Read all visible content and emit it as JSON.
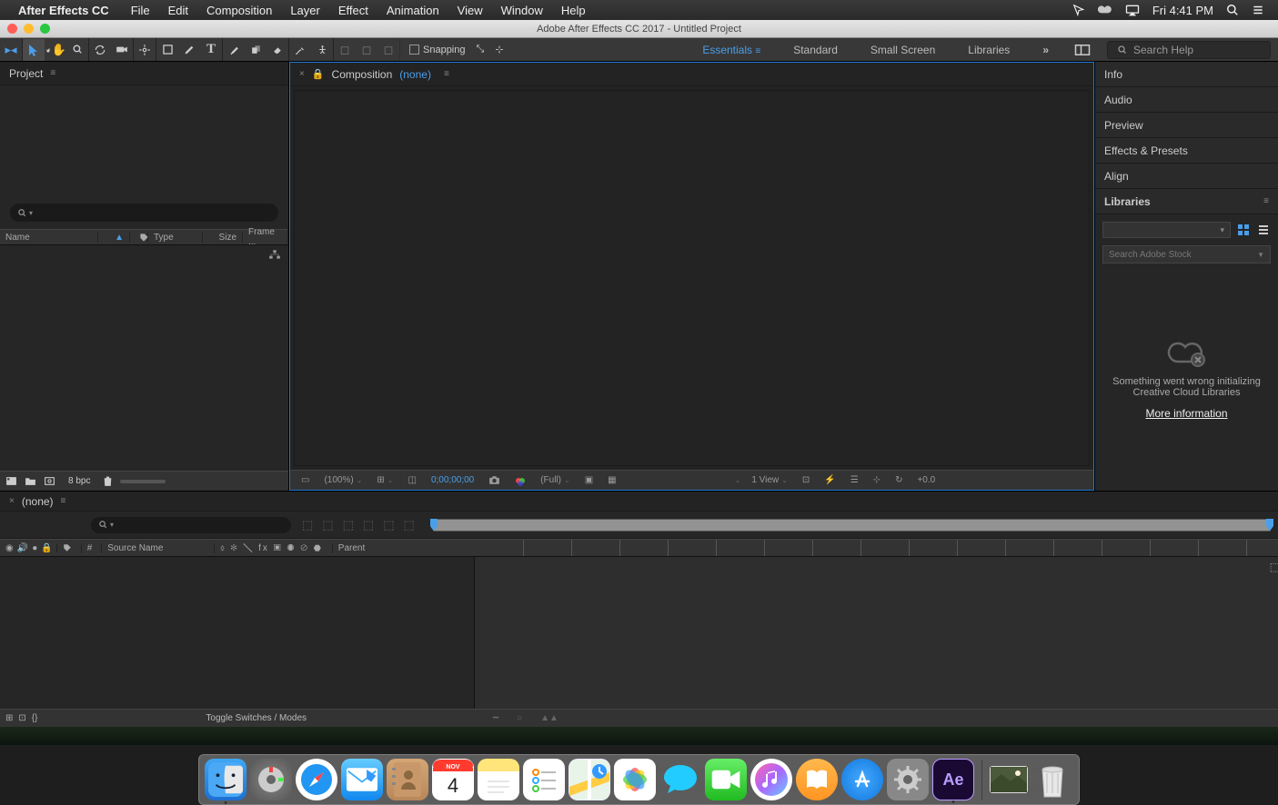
{
  "menubar": {
    "app_name": "After Effects CC",
    "items": [
      "File",
      "Edit",
      "Composition",
      "Layer",
      "Effect",
      "Animation",
      "View",
      "Window",
      "Help"
    ],
    "clock": "Fri 4:41 PM"
  },
  "window": {
    "title": "Adobe After Effects CC 2017 - Untitled Project"
  },
  "toolbar": {
    "snapping_label": "Snapping",
    "workspaces": [
      "Essentials",
      "Standard",
      "Small Screen",
      "Libraries"
    ],
    "active_workspace": "Essentials",
    "search_placeholder": "Search Help"
  },
  "project": {
    "tab": "Project",
    "headers": {
      "name": "Name",
      "type": "Type",
      "size": "Size",
      "frame": "Frame ..."
    },
    "bpc": "8 bpc"
  },
  "composition": {
    "tab_prefix": "Composition",
    "tab_none": "(none)",
    "footer": {
      "zoom": "(100%)",
      "timecode": "0;00;00;00",
      "resolution": "(Full)",
      "view": "1 View",
      "exposure": "+0.0"
    }
  },
  "right_panels": {
    "items": [
      "Info",
      "Audio",
      "Preview",
      "Effects & Presets",
      "Align",
      "Libraries"
    ],
    "libraries": {
      "search_placeholder": "Search Adobe Stock",
      "error_l1": "Something went wrong initializing",
      "error_l2": "Creative Cloud Libraries",
      "more_info": "More information"
    }
  },
  "timeline": {
    "tab": "(none)",
    "header": {
      "num": "#",
      "source": "Source Name",
      "parent": "Parent"
    },
    "toggle": "Toggle Switches / Modes"
  },
  "dock": {
    "apps": [
      "Finder",
      "Launchpad",
      "Safari",
      "Mail",
      "Contacts",
      "Calendar",
      "Notes",
      "Reminders",
      "Maps",
      "Photos",
      "Messages",
      "FaceTime",
      "iTunes",
      "iBooks",
      "App Store",
      "Preferences",
      "After Effects"
    ],
    "calendar": {
      "month": "NOV",
      "day": "4"
    }
  }
}
